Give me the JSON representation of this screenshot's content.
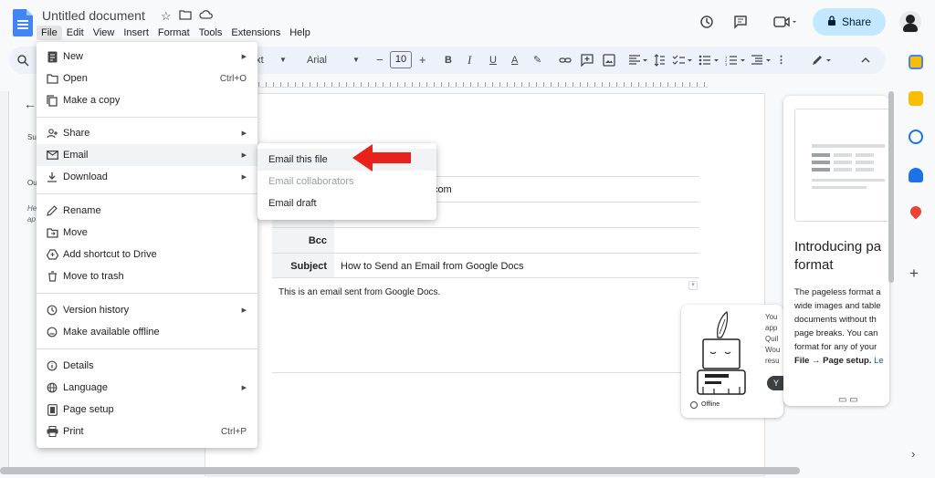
{
  "doc": {
    "title": "Untitled document",
    "menus": [
      "File",
      "Edit",
      "View",
      "Insert",
      "Format",
      "Tools",
      "Extensions",
      "Help"
    ],
    "share_label": "Share"
  },
  "toolbar": {
    "style_partial": "ext",
    "font": "Arial",
    "font_size": "10",
    "minus": "−",
    "plus": "+",
    "bold": "B",
    "italic": "I",
    "underline": "U",
    "text_color": "A"
  },
  "file_menu": {
    "items": [
      {
        "label": "New",
        "icon": "new-doc-icon"
      },
      {
        "label": "Open",
        "shortcut": "Ctrl+O",
        "icon": "folder-icon"
      },
      {
        "label": "Make a copy",
        "icon": "copy-icon"
      },
      {
        "label": "Share",
        "icon": "person-add-icon"
      },
      {
        "label": "Email",
        "icon": "mail-icon"
      },
      {
        "label": "Download",
        "icon": "download-icon"
      },
      {
        "label": "Rename",
        "icon": "pencil-icon"
      },
      {
        "label": "Move",
        "icon": "move-folder-icon"
      },
      {
        "label": "Add shortcut to Drive",
        "icon": "drive-shortcut-icon"
      },
      {
        "label": "Move to trash",
        "icon": "trash-icon"
      },
      {
        "label": "Version history",
        "icon": "history-icon"
      },
      {
        "label": "Make available offline",
        "icon": "offline-icon"
      },
      {
        "label": "Details",
        "icon": "info-icon"
      },
      {
        "label": "Language",
        "icon": "globe-icon"
      },
      {
        "label": "Page setup",
        "icon": "page-setup-icon"
      },
      {
        "label": "Print",
        "shortcut": "Ctrl+P",
        "icon": "print-icon"
      }
    ]
  },
  "email_submenu": {
    "items": [
      {
        "label": "Email this file",
        "enabled": true
      },
      {
        "label": "Email collaborators",
        "enabled": false
      },
      {
        "label": "Email draft",
        "enabled": true
      }
    ]
  },
  "email_draft": {
    "to_partial": "il.com",
    "bcc_label": "Bcc",
    "subject_label": "Subject",
    "subject_value": "How to Send an Email from Google Docs",
    "body": "This is an email sent from Google Docs."
  },
  "left_panel": {
    "labels": [
      "Su",
      "Ou",
      "He",
      "ap"
    ]
  },
  "offline_card": {
    "text": "You\napp\nQuil\nWou\nresu",
    "button_partial": "Y",
    "label": "Offline"
  },
  "preview_panel": {
    "title_line1": "Introducing pa",
    "title_line2": "format",
    "desc_lines": [
      "The pageless format a",
      "wide images and table",
      "documents without th",
      "page breaks. You can",
      "format for any of your"
    ],
    "desc_last_bold": "File → Page setup.",
    "desc_last_link": " Le"
  },
  "colors": {
    "accent": "#4285f4",
    "share_bg": "#c2e7ff",
    "arrow": "#e8211b"
  }
}
